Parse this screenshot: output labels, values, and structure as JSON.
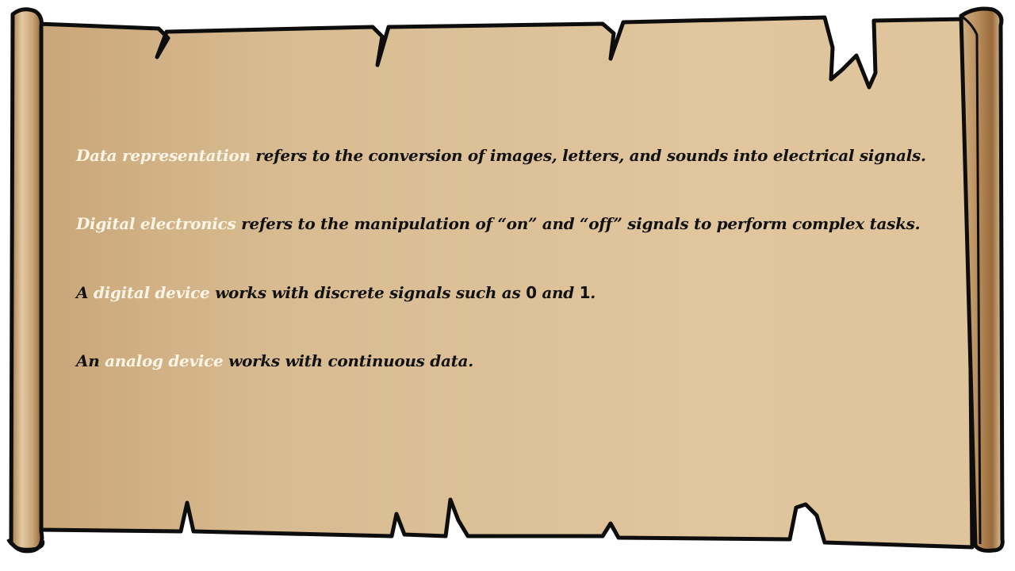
{
  "colors": {
    "parchment": "#dcc29a",
    "term_highlight": "#fdf6e6",
    "text": "#111111",
    "outline": "#0d0d0d"
  },
  "lines": [
    {
      "term": "Data representation",
      "rest": " refers to the conversion of images, letters, and sounds into electrical signals."
    },
    {
      "term": "Digital electronics",
      "rest": " refers to the manipulation of “on” and “off” signals to perform complex tasks."
    },
    {
      "prefix": "A ",
      "term": "digital device",
      "rest_a": " works with discrete signals such as ",
      "digit_a": "0",
      "mid": " and ",
      "digit_b": "1",
      "end": "."
    },
    {
      "prefix": "An ",
      "term": "analog device",
      "rest": " works with continuous data."
    }
  ]
}
